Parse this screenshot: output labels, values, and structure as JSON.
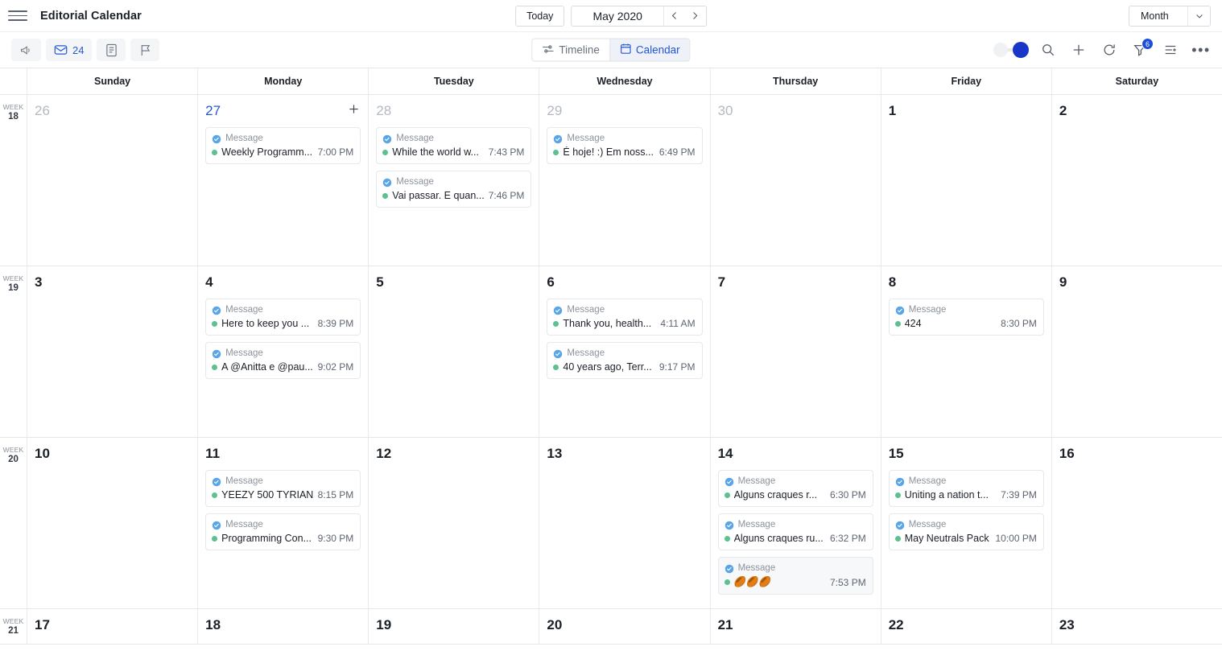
{
  "app": {
    "title": "Editorial Calendar",
    "menu_icon": "hamburger-icon"
  },
  "topbar": {
    "today_label": "Today",
    "period_label": "May 2020",
    "prev_icon": "chevron-left-icon",
    "next_icon": "chevron-right-icon",
    "view_scale": "Month",
    "view_caret_icon": "chevron-down-icon"
  },
  "toolbar": {
    "left_items": [
      {
        "name": "announcement-icon",
        "label": ""
      },
      {
        "name": "inbox-icon",
        "label": "24"
      },
      {
        "name": "notes-icon",
        "label": ""
      },
      {
        "name": "flag-icon",
        "label": ""
      }
    ],
    "inbox_count": "24",
    "tabs": [
      {
        "label": "Timeline",
        "icon": "timeline-icon",
        "active": false
      },
      {
        "label": "Calendar",
        "icon": "calendar-icon",
        "active": true
      }
    ],
    "right_items": [
      {
        "name": "view-toggle",
        "label": ""
      },
      {
        "name": "search-icon",
        "label": ""
      },
      {
        "name": "add-icon",
        "label": ""
      },
      {
        "name": "refresh-icon",
        "label": ""
      },
      {
        "name": "filter-icon",
        "label": "",
        "badge": "6"
      },
      {
        "name": "sort-icon",
        "label": ""
      },
      {
        "name": "more-icon",
        "label": "..."
      }
    ],
    "filter_badge": "6",
    "more_label": "•••"
  },
  "calendar": {
    "weekdays": [
      "Sunday",
      "Monday",
      "Tuesday",
      "Wednesday",
      "Thursday",
      "Friday",
      "Saturday"
    ],
    "week_word": "WEEK",
    "event_type_label": "Message",
    "weeks": [
      {
        "week_number": "18",
        "days": [
          {
            "num": "26",
            "muted": true,
            "today": false,
            "events": []
          },
          {
            "num": "27",
            "muted": false,
            "today": true,
            "show_add": true,
            "events": [
              {
                "type": "Message",
                "title": "Weekly Programm...",
                "time": "7:00 PM"
              }
            ]
          },
          {
            "num": "28",
            "muted": true,
            "today": false,
            "events": [
              {
                "type": "Message",
                "title": "While the world w...",
                "time": "7:43 PM"
              },
              {
                "type": "Message",
                "title": "Vai passar. E quan...",
                "time": "7:46 PM"
              }
            ]
          },
          {
            "num": "29",
            "muted": true,
            "today": false,
            "events": [
              {
                "type": "Message",
                "title": "É hoje! :) Em noss...",
                "time": "6:49 PM"
              }
            ]
          },
          {
            "num": "30",
            "muted": true,
            "today": false,
            "events": []
          },
          {
            "num": "1",
            "muted": false,
            "today": false,
            "events": []
          },
          {
            "num": "2",
            "muted": false,
            "today": false,
            "events": []
          }
        ]
      },
      {
        "week_number": "19",
        "days": [
          {
            "num": "3",
            "muted": false,
            "today": false,
            "events": []
          },
          {
            "num": "4",
            "muted": false,
            "today": false,
            "events": [
              {
                "type": "Message",
                "title": "Here to keep you ...",
                "time": "8:39 PM"
              },
              {
                "type": "Message",
                "title": "A @Anitta e @pau...",
                "time": "9:02 PM"
              }
            ]
          },
          {
            "num": "5",
            "muted": false,
            "today": false,
            "events": []
          },
          {
            "num": "6",
            "muted": false,
            "today": false,
            "events": [
              {
                "type": "Message",
                "title": "Thank you, health...",
                "time": "4:11 AM"
              },
              {
                "type": "Message",
                "title": "40 years ago, Terr...",
                "time": "9:17 PM"
              }
            ]
          },
          {
            "num": "7",
            "muted": false,
            "today": false,
            "events": []
          },
          {
            "num": "8",
            "muted": false,
            "today": false,
            "events": [
              {
                "type": "Message",
                "title": "424",
                "time": "8:30 PM"
              }
            ]
          },
          {
            "num": "9",
            "muted": false,
            "today": false,
            "events": []
          }
        ]
      },
      {
        "week_number": "20",
        "days": [
          {
            "num": "10",
            "muted": false,
            "today": false,
            "events": []
          },
          {
            "num": "11",
            "muted": false,
            "today": false,
            "events": [
              {
                "type": "Message",
                "title": "YEEZY 500 TYRIAN",
                "time": "8:15 PM"
              },
              {
                "type": "Message",
                "title": "Programming Con...",
                "time": "9:30 PM"
              }
            ]
          },
          {
            "num": "12",
            "muted": false,
            "today": false,
            "events": []
          },
          {
            "num": "13",
            "muted": false,
            "today": false,
            "events": []
          },
          {
            "num": "14",
            "muted": false,
            "today": false,
            "events": [
              {
                "type": "Message",
                "title": "Alguns craques r...",
                "time": "6:30 PM"
              },
              {
                "type": "Message",
                "title": "Alguns craques ru...",
                "time": "6:32 PM"
              },
              {
                "type": "Message",
                "title": "🏉🏉🏉",
                "time": "7:53 PM",
                "shaded": true
              }
            ]
          },
          {
            "num": "15",
            "muted": false,
            "today": false,
            "events": [
              {
                "type": "Message",
                "title": "Uniting a nation t...",
                "time": "7:39 PM"
              },
              {
                "type": "Message",
                "title": "May Neutrals Pack",
                "time": "10:00 PM"
              }
            ]
          },
          {
            "num": "16",
            "muted": false,
            "today": false,
            "events": []
          }
        ]
      },
      {
        "week_number": "21",
        "partial": true,
        "days": [
          {
            "num": "17",
            "muted": false,
            "today": false,
            "events": []
          },
          {
            "num": "18",
            "muted": false,
            "today": false,
            "events": []
          },
          {
            "num": "19",
            "muted": false,
            "today": false,
            "events": []
          },
          {
            "num": "20",
            "muted": false,
            "today": false,
            "events": []
          },
          {
            "num": "21",
            "muted": false,
            "today": false,
            "events": []
          },
          {
            "num": "22",
            "muted": false,
            "today": false,
            "events": []
          },
          {
            "num": "23",
            "muted": false,
            "today": false,
            "events": []
          }
        ]
      }
    ]
  },
  "colors": {
    "accent_blue": "#2457d6",
    "toggle_blue": "#1836c7",
    "badge_blue": "#1d4ed8",
    "twitter_blue": "#5aa5e8",
    "status_green": "#5cc08f",
    "muted_text": "#b4b9c0"
  }
}
